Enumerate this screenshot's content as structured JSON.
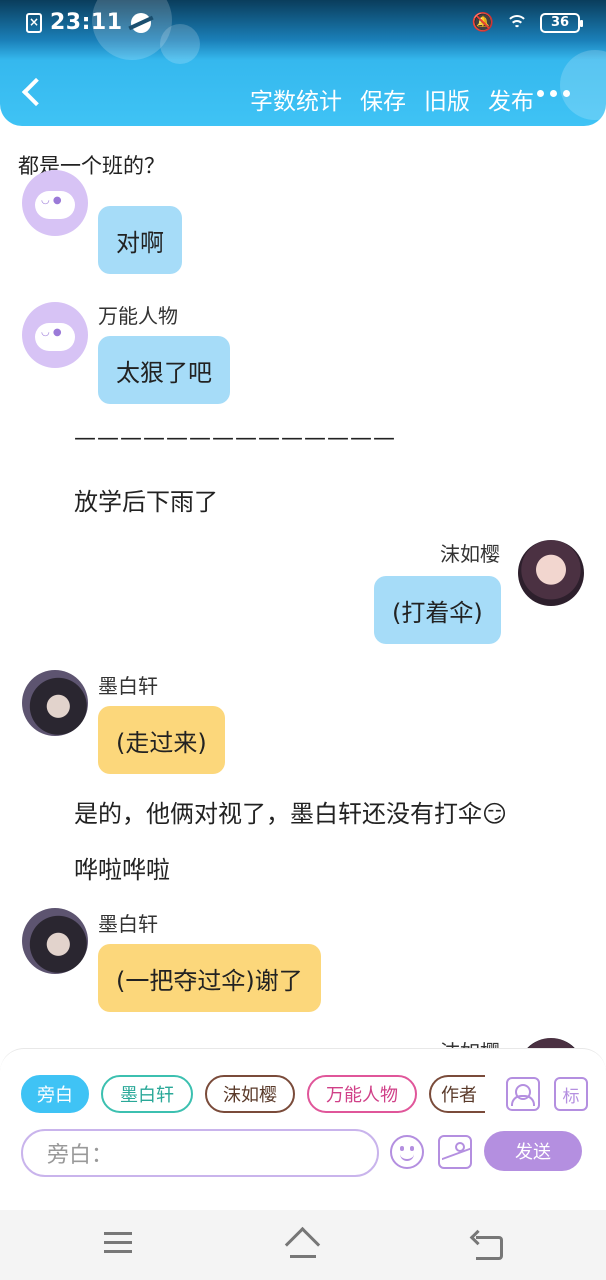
{
  "status_bar": {
    "time": "23:11",
    "battery": "36"
  },
  "header": {
    "actions": [
      "字数统计",
      "保存",
      "旧版",
      "发布"
    ]
  },
  "chat": {
    "top_text": "都是一个班的？",
    "messages": [
      {
        "name": "",
        "text": "对啊"
      },
      {
        "name": "万能人物",
        "text": "太狠了吧"
      },
      {
        "divider": "——————————————"
      },
      {
        "narration": "放学后下雨了"
      },
      {
        "name": "沫如樱",
        "text": "(打着伞)"
      },
      {
        "name": "墨白轩",
        "text": "(走过来)"
      },
      {
        "narration": "是的，他俩对视了，墨白轩还没有打伞😏"
      },
      {
        "narration": "哗啦哗啦"
      },
      {
        "name": "墨白轩",
        "text": "(一把夺过伞)谢了"
      },
      {
        "name": "沫如樱",
        "text": ""
      }
    ]
  },
  "panel": {
    "chips": [
      "旁白",
      "墨白轩",
      "沫如樱",
      "万能人物",
      "作者"
    ],
    "tag_label": "标",
    "input_placeholder": "旁白：",
    "send_label": "发送"
  }
}
